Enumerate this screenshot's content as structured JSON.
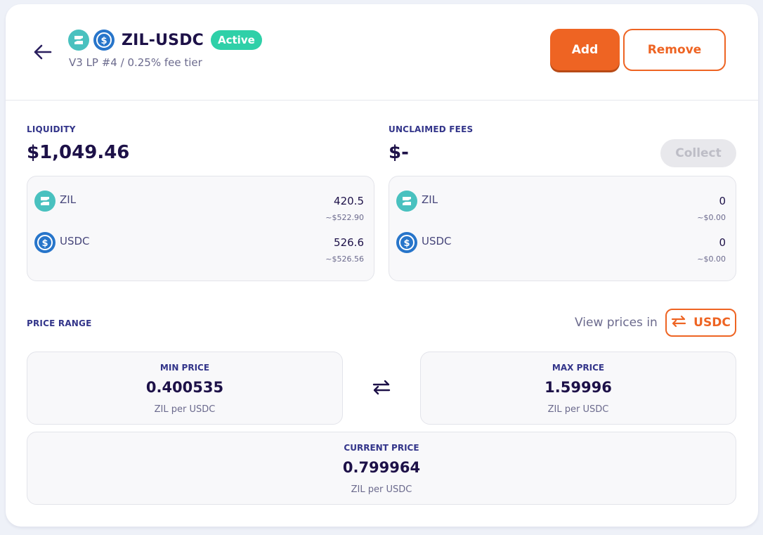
{
  "header": {
    "pair": "ZIL-USDC",
    "status": "Active",
    "subtitle": "V3 LP #4 / 0.25% fee tier",
    "add_label": "Add",
    "remove_label": "Remove",
    "icons": [
      "zil-icon",
      "usdc-icon",
      "back-arrow-icon"
    ]
  },
  "liquidity": {
    "label": "LIQUIDITY",
    "value": "$1,049.46",
    "tokens": [
      {
        "symbol": "ZIL",
        "amount": "420.5",
        "usd": "~$522.90"
      },
      {
        "symbol": "USDC",
        "amount": "526.6",
        "usd": "~$526.56"
      }
    ]
  },
  "fees": {
    "label": "UNCLAIMED FEES",
    "value": "$-",
    "collect_label": "Collect",
    "tokens": [
      {
        "symbol": "ZIL",
        "amount": "0",
        "usd": "~$0.00"
      },
      {
        "symbol": "USDC",
        "amount": "0",
        "usd": "~$0.00"
      }
    ]
  },
  "price_range": {
    "label": "PRICE RANGE",
    "view_prices_label": "View prices in",
    "toggle_label": "USDC",
    "min": {
      "label": "MIN PRICE",
      "value": "0.400535",
      "unit": "ZIL per USDC"
    },
    "max": {
      "label": "MAX PRICE",
      "value": "1.59996",
      "unit": "ZIL per USDC"
    },
    "current": {
      "label": "CURRENT PRICE",
      "value": "0.799964",
      "unit": "ZIL per USDC"
    }
  },
  "colors": {
    "accent": "#ee6423",
    "active_badge": "#2fd0a8",
    "zil": "#49c1bf",
    "usdc": "#2775ca",
    "heading": "#1d1148",
    "label": "#33358a"
  }
}
